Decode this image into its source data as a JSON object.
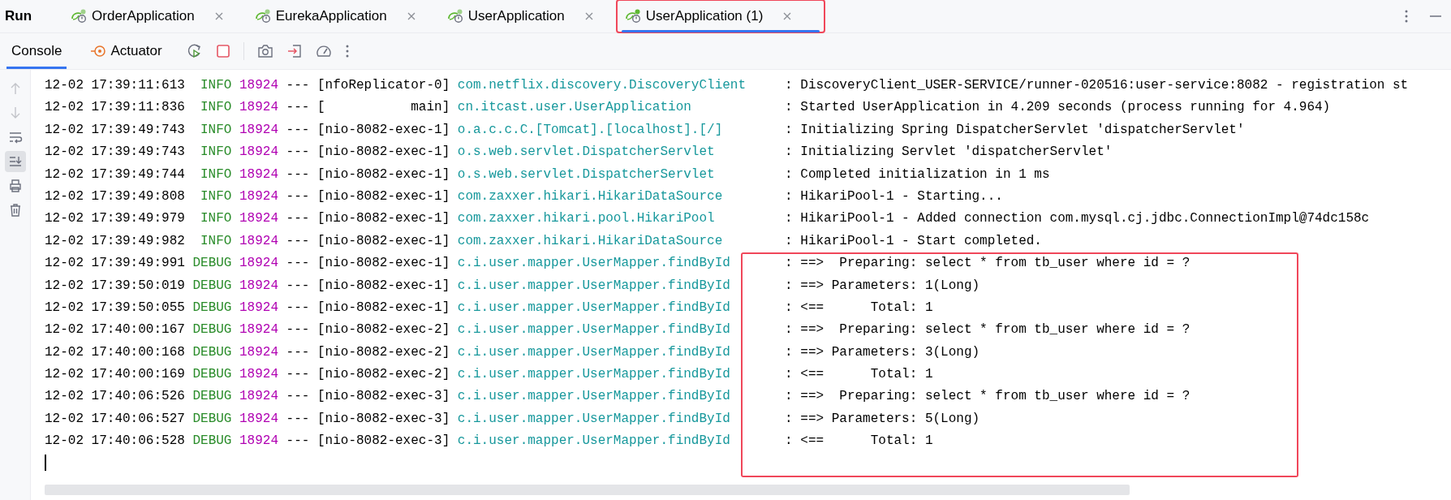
{
  "panel_title": "Run",
  "run_tabs": [
    {
      "label": "OrderApplication",
      "selected": false,
      "highlighted": false
    },
    {
      "label": "EurekaApplication",
      "selected": false,
      "highlighted": false
    },
    {
      "label": "UserApplication",
      "selected": false,
      "highlighted": false
    },
    {
      "label": "UserApplication (1)",
      "selected": true,
      "highlighted": true
    }
  ],
  "view_tabs": [
    {
      "label": "Console",
      "kind": "console",
      "selected": true
    },
    {
      "label": "Actuator",
      "kind": "actuator",
      "selected": false
    }
  ],
  "gutter_buttons": [
    {
      "kind": "up",
      "disabled": true,
      "selected": false
    },
    {
      "kind": "down",
      "disabled": true,
      "selected": false
    },
    {
      "kind": "wrap",
      "disabled": false,
      "selected": false
    },
    {
      "kind": "scroll-end",
      "disabled": false,
      "selected": true
    },
    {
      "kind": "print",
      "disabled": false,
      "selected": false
    },
    {
      "kind": "clear",
      "disabled": false,
      "selected": false
    }
  ],
  "log_rows": [
    {
      "time": "12-02 17:39:11:613",
      "level": "INFO",
      "pid": "18924",
      "sep": "---",
      "thread": "[nfoReplicator-0]",
      "logger": "com.netflix.discovery.DiscoveryClient",
      "message": ": DiscoveryClient_USER-SERVICE/runner-020516:user-service:8082 - registration st",
      "highlighted": false
    },
    {
      "time": "12-02 17:39:11:836",
      "level": "INFO",
      "pid": "18924",
      "sep": "---",
      "thread": "[           main]",
      "logger": "cn.itcast.user.UserApplication",
      "message": ": Started UserApplication in 4.209 seconds (process running for 4.964)",
      "highlighted": false
    },
    {
      "time": "12-02 17:39:49:743",
      "level": "INFO",
      "pid": "18924",
      "sep": "---",
      "thread": "[nio-8082-exec-1]",
      "logger": "o.a.c.c.C.[Tomcat].[localhost].[/]",
      "message": ": Initializing Spring DispatcherServlet 'dispatcherServlet'",
      "highlighted": false
    },
    {
      "time": "12-02 17:39:49:743",
      "level": "INFO",
      "pid": "18924",
      "sep": "---",
      "thread": "[nio-8082-exec-1]",
      "logger": "o.s.web.servlet.DispatcherServlet",
      "message": ": Initializing Servlet 'dispatcherServlet'",
      "highlighted": false
    },
    {
      "time": "12-02 17:39:49:744",
      "level": "INFO",
      "pid": "18924",
      "sep": "---",
      "thread": "[nio-8082-exec-1]",
      "logger": "o.s.web.servlet.DispatcherServlet",
      "message": ": Completed initialization in 1 ms",
      "highlighted": false
    },
    {
      "time": "12-02 17:39:49:808",
      "level": "INFO",
      "pid": "18924",
      "sep": "---",
      "thread": "[nio-8082-exec-1]",
      "logger": "com.zaxxer.hikari.HikariDataSource",
      "message": ": HikariPool-1 - Starting...",
      "highlighted": false
    },
    {
      "time": "12-02 17:39:49:979",
      "level": "INFO",
      "pid": "18924",
      "sep": "---",
      "thread": "[nio-8082-exec-1]",
      "logger": "com.zaxxer.hikari.pool.HikariPool",
      "message": ": HikariPool-1 - Added connection com.mysql.cj.jdbc.ConnectionImpl@74dc158c",
      "highlighted": false
    },
    {
      "time": "12-02 17:39:49:982",
      "level": "INFO",
      "pid": "18924",
      "sep": "---",
      "thread": "[nio-8082-exec-1]",
      "logger": "com.zaxxer.hikari.HikariDataSource",
      "message": ": HikariPool-1 - Start completed.",
      "highlighted": false
    },
    {
      "time": "12-02 17:39:49:991",
      "level": "DEBUG",
      "pid": "18924",
      "sep": "---",
      "thread": "[nio-8082-exec-1]",
      "logger": "c.i.user.mapper.UserMapper.findById",
      "message": ": ==>  Preparing: select * from tb_user where id = ?",
      "highlighted": true
    },
    {
      "time": "12-02 17:39:50:019",
      "level": "DEBUG",
      "pid": "18924",
      "sep": "---",
      "thread": "[nio-8082-exec-1]",
      "logger": "c.i.user.mapper.UserMapper.findById",
      "message": ": ==> Parameters: 1(Long)",
      "highlighted": true
    },
    {
      "time": "12-02 17:39:50:055",
      "level": "DEBUG",
      "pid": "18924",
      "sep": "---",
      "thread": "[nio-8082-exec-1]",
      "logger": "c.i.user.mapper.UserMapper.findById",
      "message": ": <==      Total: 1",
      "highlighted": true
    },
    {
      "time": "12-02 17:40:00:167",
      "level": "DEBUG",
      "pid": "18924",
      "sep": "---",
      "thread": "[nio-8082-exec-2]",
      "logger": "c.i.user.mapper.UserMapper.findById",
      "message": ": ==>  Preparing: select * from tb_user where id = ?",
      "highlighted": true
    },
    {
      "time": "12-02 17:40:00:168",
      "level": "DEBUG",
      "pid": "18924",
      "sep": "---",
      "thread": "[nio-8082-exec-2]",
      "logger": "c.i.user.mapper.UserMapper.findById",
      "message": ": ==> Parameters: 3(Long)",
      "highlighted": true
    },
    {
      "time": "12-02 17:40:00:169",
      "level": "DEBUG",
      "pid": "18924",
      "sep": "---",
      "thread": "[nio-8082-exec-2]",
      "logger": "c.i.user.mapper.UserMapper.findById",
      "message": ": <==      Total: 1",
      "highlighted": true
    },
    {
      "time": "12-02 17:40:06:526",
      "level": "DEBUG",
      "pid": "18924",
      "sep": "---",
      "thread": "[nio-8082-exec-3]",
      "logger": "c.i.user.mapper.UserMapper.findById",
      "message": ": ==>  Preparing: select * from tb_user where id = ?",
      "highlighted": true
    },
    {
      "time": "12-02 17:40:06:527",
      "level": "DEBUG",
      "pid": "18924",
      "sep": "---",
      "thread": "[nio-8082-exec-3]",
      "logger": "c.i.user.mapper.UserMapper.findById",
      "message": ": ==> Parameters: 5(Long)",
      "highlighted": true
    },
    {
      "time": "12-02 17:40:06:528",
      "level": "DEBUG",
      "pid": "18924",
      "sep": "---",
      "thread": "[nio-8082-exec-3]",
      "logger": "c.i.user.mapper.UserMapper.findById",
      "message": ": <==      Total: 1",
      "highlighted": true
    }
  ]
}
